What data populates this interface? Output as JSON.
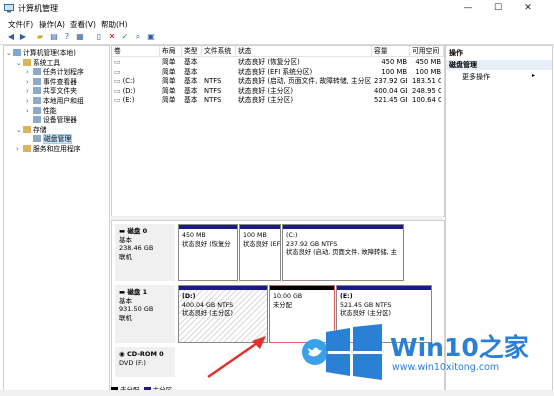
{
  "window": {
    "title": "计算机管理",
    "minimize": "—",
    "maximize": "☐",
    "close": "✕"
  },
  "menu": [
    "文件(F)",
    "操作(A)",
    "查看(V)",
    "帮助(H)"
  ],
  "toolbar_icons": [
    "back-arrow-icon",
    "forward-arrow-icon",
    "up-folder-icon",
    "properties-icon",
    "help-icon",
    "show-hide-icon",
    "properties-sheet-icon",
    "delete-icon",
    "check-icon",
    "search-icon",
    "refresh-icon"
  ],
  "tree": [
    {
      "label": "计算机管理(本地)",
      "indent": 0,
      "exp": "⌄"
    },
    {
      "label": "系统工具",
      "indent": 1,
      "exp": "⌄"
    },
    {
      "label": "任务计划程序",
      "indent": 2,
      "exp": "›"
    },
    {
      "label": "事件查看器",
      "indent": 2,
      "exp": "›"
    },
    {
      "label": "共享文件夹",
      "indent": 2,
      "exp": "›"
    },
    {
      "label": "本地用户和组",
      "indent": 2,
      "exp": "›"
    },
    {
      "label": "性能",
      "indent": 2,
      "exp": "›"
    },
    {
      "label": "设备管理器",
      "indent": 2,
      "exp": ""
    },
    {
      "label": "存储",
      "indent": 1,
      "exp": "⌄"
    },
    {
      "label": "磁盘管理",
      "indent": 2,
      "exp": "",
      "selected": true
    },
    {
      "label": "服务和应用程序",
      "indent": 1,
      "exp": "›"
    }
  ],
  "volume_columns": [
    "卷",
    "布局",
    "类型",
    "文件系统",
    "状态",
    "容量",
    "可用空间"
  ],
  "volumes": [
    {
      "vol": "",
      "layout": "简单",
      "type": "基本",
      "fs": "",
      "status": "状态良好 (恢复分区)",
      "cap": "450 MB",
      "free": "450 MB"
    },
    {
      "vol": "",
      "layout": "简单",
      "type": "基本",
      "fs": "",
      "status": "状态良好 (EFI 系统分区)",
      "cap": "100 MB",
      "free": "100 MB"
    },
    {
      "vol": "(C:)",
      "layout": "简单",
      "type": "基本",
      "fs": "NTFS",
      "status": "状态良好 (启动, 页面文件, 故障转储, 主分区)",
      "cap": "237.92 GB",
      "free": "183.51 G"
    },
    {
      "vol": "(D:)",
      "layout": "简单",
      "type": "基本",
      "fs": "NTFS",
      "status": "状态良好 (主分区)",
      "cap": "400.04 GB",
      "free": "248.95 G"
    },
    {
      "vol": "(E:)",
      "layout": "简单",
      "type": "基本",
      "fs": "NTFS",
      "status": "状态良好 (主分区)",
      "cap": "521.45 GB",
      "free": "100.64 G"
    }
  ],
  "disk0": {
    "name": "磁盘 0",
    "type": "基本",
    "size": "238.46 GB",
    "state": "联机",
    "parts": [
      {
        "line1": "",
        "line2": "450 MB",
        "line3": "状态良好 (恢复分"
      },
      {
        "line1": "",
        "line2": "100 MB",
        "line3": "状态良好 (EF"
      },
      {
        "line1": "(C:)",
        "line2": "237.92 GB NTFS",
        "line3": "状态良好 (启动, 页面文件, 故障转储, 主"
      }
    ]
  },
  "disk1": {
    "name": "磁盘 1",
    "type": "基本",
    "size": "931.50 GB",
    "state": "联机",
    "parts": [
      {
        "line1": "(D:)",
        "line2": "400.04 GB NTFS",
        "line3": "状态良好 (主分区)"
      },
      {
        "line1": "",
        "line2": "10.00 GB",
        "line3": "未分配"
      },
      {
        "line1": "(E:)",
        "line2": "521.45 GB NTFS",
        "line3": "状态良好 (主分区)"
      }
    ]
  },
  "cdrom": {
    "name": "CD-ROM 0",
    "type": "DVD (F:)",
    "state": ""
  },
  "legend": [
    {
      "label": "未分配",
      "color": "#000000"
    },
    {
      "label": "主分区",
      "color": "#1a1a8a"
    }
  ],
  "actions": {
    "header": "操作",
    "section": "磁盘管理",
    "more": "更多操作"
  },
  "watermark": {
    "brand": "Win10",
    "brand2": "之家",
    "url": "www.win10xitong.com"
  },
  "colors": {
    "accent": "#1a1a8a",
    "selection": "#cce8ff",
    "win_blue": "#2a7fd6",
    "arrow_red": "#e0312b"
  }
}
